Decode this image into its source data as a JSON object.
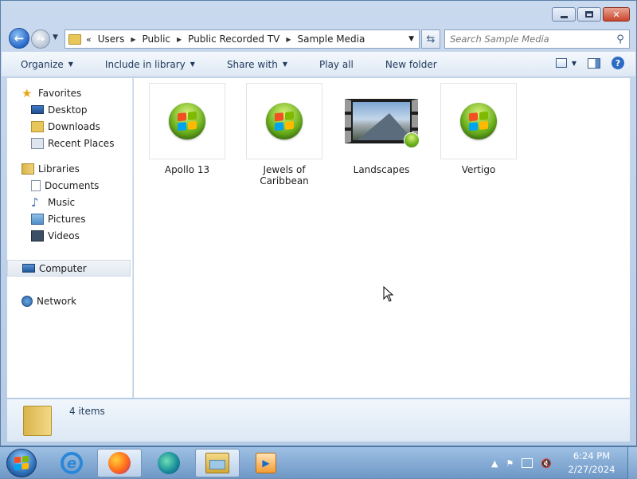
{
  "window": {
    "caption_buttons": {
      "minimize": "minimize-icon",
      "maximize": "maximize-icon",
      "close": "close-icon"
    }
  },
  "address_bar": {
    "lead": "«",
    "crumbs": [
      "Users",
      "Public",
      "Public Recorded TV",
      "Sample Media"
    ]
  },
  "search": {
    "placeholder": "Search Sample Media"
  },
  "toolbar": {
    "organize": "Organize",
    "include_in_library": "Include in library",
    "share_with": "Share with",
    "play_all": "Play all",
    "new_folder": "New folder"
  },
  "nav": {
    "favorites": {
      "label": "Favorites",
      "items": [
        "Desktop",
        "Downloads",
        "Recent Places"
      ]
    },
    "libraries": {
      "label": "Libraries",
      "items": [
        "Documents",
        "Music",
        "Pictures",
        "Videos"
      ]
    },
    "computer": "Computer",
    "network": "Network"
  },
  "files": [
    {
      "name": "Apollo 13",
      "type": "media-orb"
    },
    {
      "name": "Jewels of Caribbean",
      "type": "media-orb"
    },
    {
      "name": "Landscapes",
      "type": "video-thumbnail"
    },
    {
      "name": "Vertigo",
      "type": "media-orb"
    }
  ],
  "details": {
    "count": "4 items"
  },
  "taskbar": {
    "apps": [
      "internet-explorer-icon",
      "firefox-icon",
      "edge-icon",
      "file-explorer-icon",
      "media-player-icon"
    ],
    "clock_time": "6:24 PM",
    "clock_date": "2/27/2024"
  },
  "colors": {
    "accent": "#2868c8",
    "window_frame": "#b6cbe6",
    "taskbar": "#6f98c7"
  }
}
